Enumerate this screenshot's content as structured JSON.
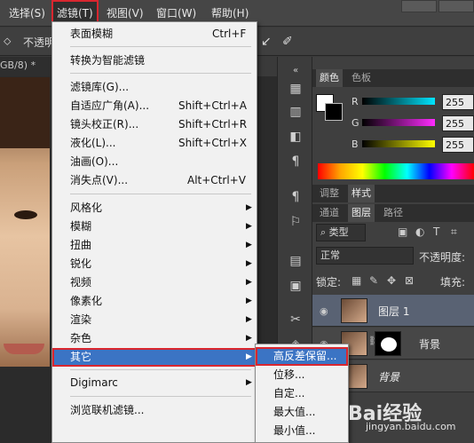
{
  "menubar": {
    "items": [
      "选择(S)",
      "滤镜(T)",
      "视图(V)",
      "窗口(W)",
      "帮助(H)"
    ],
    "active_index": 1
  },
  "options_bar": {
    "opacity_label": "不透明",
    "doc_tab": "GB/8) *"
  },
  "filter_menu": {
    "items": [
      {
        "label": "表面模糊",
        "shortcut": "Ctrl+F"
      },
      {
        "label": "转换为智能滤镜"
      },
      {
        "label": "滤镜库(G)..."
      },
      {
        "label": "自适应广角(A)...",
        "shortcut": "Shift+Ctrl+A"
      },
      {
        "label": "镜头校正(R)...",
        "shortcut": "Shift+Ctrl+R"
      },
      {
        "label": "液化(L)...",
        "shortcut": "Shift+Ctrl+X"
      },
      {
        "label": "油画(O)..."
      },
      {
        "label": "消失点(V)...",
        "shortcut": "Alt+Ctrl+V"
      },
      {
        "label": "风格化",
        "submenu": true
      },
      {
        "label": "模糊",
        "submenu": true
      },
      {
        "label": "扭曲",
        "submenu": true
      },
      {
        "label": "锐化",
        "submenu": true
      },
      {
        "label": "视频",
        "submenu": true
      },
      {
        "label": "像素化",
        "submenu": true
      },
      {
        "label": "渲染",
        "submenu": true
      },
      {
        "label": "杂色",
        "submenu": true
      },
      {
        "label": "其它",
        "submenu": true,
        "highlighted": true
      },
      {
        "label": "Digimarc",
        "submenu": true
      },
      {
        "label": "浏览联机滤镜..."
      }
    ]
  },
  "other_submenu": {
    "items": [
      "高反差保留...",
      "位移...",
      "自定...",
      "最大值...",
      "最小值..."
    ],
    "highlighted_index": 0
  },
  "color_panel": {
    "tabs": [
      "颜色",
      "色板"
    ],
    "channels": [
      {
        "label": "R",
        "value": "255",
        "color": "#00e5ff"
      },
      {
        "label": "G",
        "value": "255",
        "color": "#ff2bff"
      },
      {
        "label": "B",
        "value": "255",
        "color": "#ffff00"
      }
    ]
  },
  "adjust_tabs": [
    "调整",
    "样式"
  ],
  "layers_panel": {
    "tabs": [
      "通道",
      "图层",
      "路径"
    ],
    "filter_kind": "类型",
    "blend_mode": "正常",
    "opacity_label": "不透明度:",
    "lock_label": "锁定:",
    "fill_label": "填充:",
    "layers": [
      {
        "name": "图层 1",
        "selected": true,
        "has_mask": false
      },
      {
        "name": "背景",
        "selected": false,
        "has_mask": true
      },
      {
        "name": "背景",
        "selected": false,
        "has_mask": false,
        "italic": true
      }
    ]
  },
  "watermark": {
    "brand": "Bai经验",
    "url": "jingyan.baidu.com"
  },
  "colors": {
    "menu_highlight": "#3b74c4",
    "annotation_red": "#d9262f"
  }
}
